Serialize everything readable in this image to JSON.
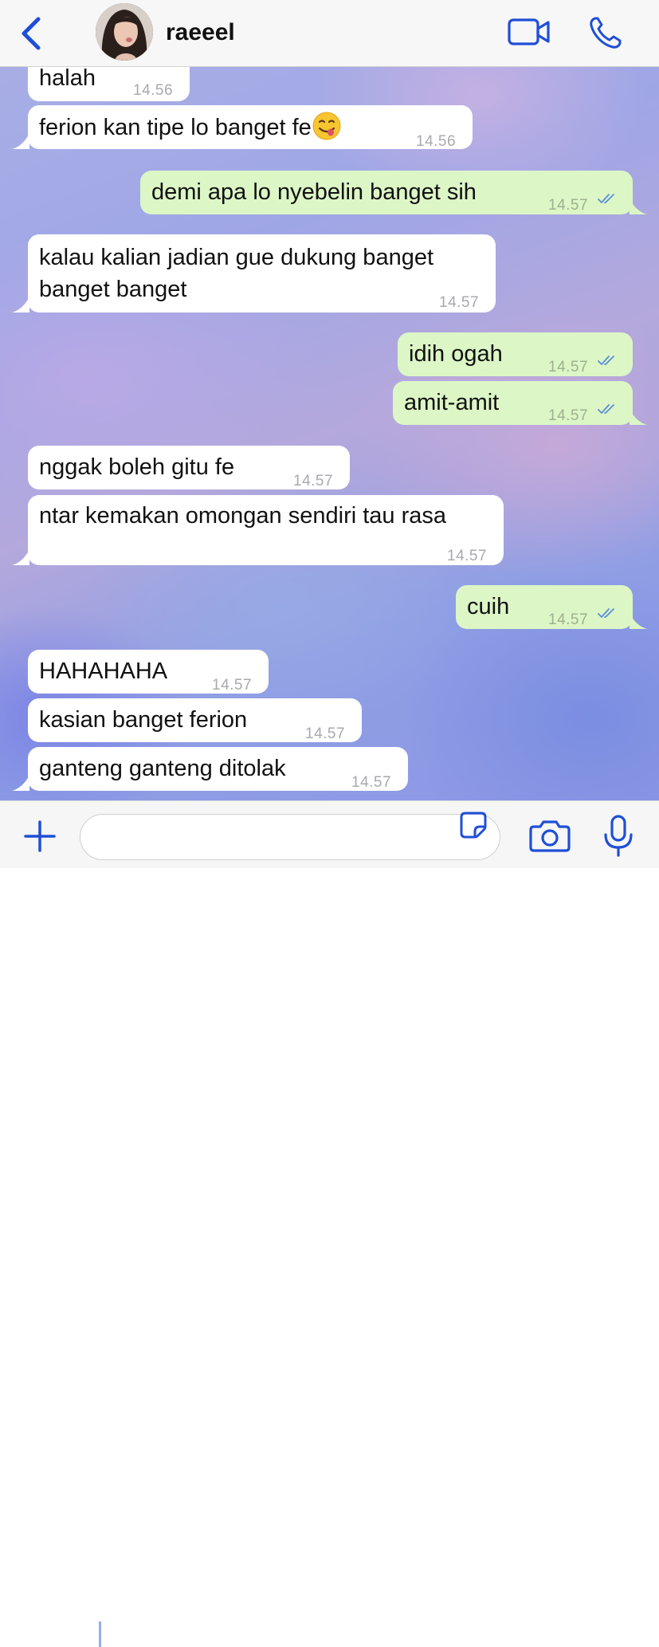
{
  "header": {
    "contact_name": "raeeel",
    "back_icon": "chevron-left-icon",
    "video_icon": "video-camera-icon",
    "call_icon": "phone-icon",
    "accent": "#1f4fd6"
  },
  "messages": [
    {
      "dir": "in",
      "text": "halah",
      "time": "14.56"
    },
    {
      "dir": "in",
      "text": "ferion kan tipe lo banget fe",
      "emoji": "face-savoring-food-emoji",
      "time": "14.56"
    },
    {
      "dir": "out",
      "text": "demi apa lo nyebelin banget sih",
      "time": "14.57"
    },
    {
      "dir": "in",
      "text": "kalau kalian jadian gue dukung banget",
      "text2": "banget banget",
      "time": "14.57"
    },
    {
      "dir": "out",
      "text": "idih ogah",
      "time": "14.57"
    },
    {
      "dir": "out",
      "text": "amit-amit",
      "time": "14.57"
    },
    {
      "dir": "in",
      "text": "nggak boleh gitu fe",
      "time": "14.57"
    },
    {
      "dir": "in",
      "text": "ntar kemakan omongan sendiri tau rasa",
      "time": "14.57"
    },
    {
      "dir": "out",
      "text": "cuih",
      "time": "14.57"
    },
    {
      "dir": "in",
      "text": "HAHAHAHA",
      "time": "14.57"
    },
    {
      "dir": "in",
      "text": "kasian banget ferion",
      "time": "14.57"
    },
    {
      "dir": "in",
      "text": "ganteng ganteng ditolak",
      "time": "14.57"
    }
  ],
  "input": {
    "value": "",
    "placeholder": "",
    "plus_icon": "plus-icon",
    "sticker_icon": "sticker-icon",
    "camera_icon": "camera-icon",
    "mic_icon": "microphone-icon"
  },
  "colors": {
    "incoming_bubble": "#ffffff",
    "outgoing_bubble": "#dcf6c6",
    "read_ticks": "#5a8fd8"
  }
}
